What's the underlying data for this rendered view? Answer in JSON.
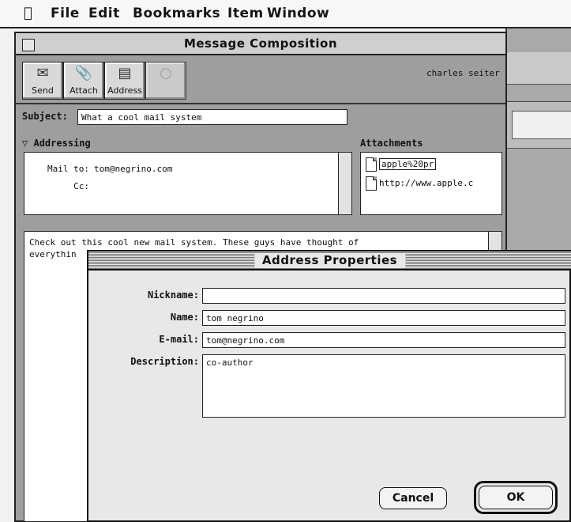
{
  "menubar": {
    "apple_glyph": "",
    "items": [
      "File",
      "Edit",
      "Bookmarks",
      "Item",
      "Window"
    ]
  },
  "composition": {
    "title": "Message Composition",
    "toolbar": {
      "send": "Send",
      "attach": "Attach",
      "address": "Address",
      "disabled": ""
    },
    "user_name": "charles seiter",
    "subject_label": "Subject:",
    "subject_value": "What a cool mail system",
    "addressing_label": "Addressing",
    "attachments_label": "Attachments",
    "mail_to_label": "Mail to:",
    "mail_to_value": "tom@negrino.com",
    "cc_label": "Cc:",
    "cc_value": "",
    "attachments": [
      "apple%20pr",
      "http://www.apple.c"
    ],
    "body_text": "Check out this cool new mail system. These guys have thought of\neverythin"
  },
  "dialog": {
    "title": "Address Properties",
    "nickname_label": "Nickname:",
    "nickname_value": "",
    "name_label": "Name:",
    "name_value": "tom negrino",
    "email_label": "E-mail:",
    "email_value": "tom@negrino.com",
    "description_label": "Description:",
    "description_value": "co-author",
    "cancel_label": "Cancel",
    "ok_label": "OK"
  }
}
